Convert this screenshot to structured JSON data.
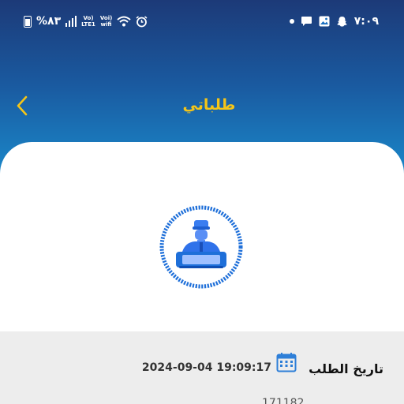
{
  "status_bar": {
    "battery": "%٨٣",
    "network": "Vo) LTE1",
    "wifi": "Voi) wifi",
    "time": "٧:٠٩"
  },
  "header": {
    "title": "طلباتي",
    "back_icon": "chevron-left-icon"
  },
  "avatar": {
    "icon": "technician-icon"
  },
  "order": {
    "date_label": "تاريخ الطلب",
    "date_value": "2024-09-04 19:09:17",
    "number_value": "171182"
  },
  "colors": {
    "header_top": "#1c3a78",
    "header_bottom": "#1a8fd0",
    "title": "#f5c518",
    "accent": "#1e6fd9"
  }
}
